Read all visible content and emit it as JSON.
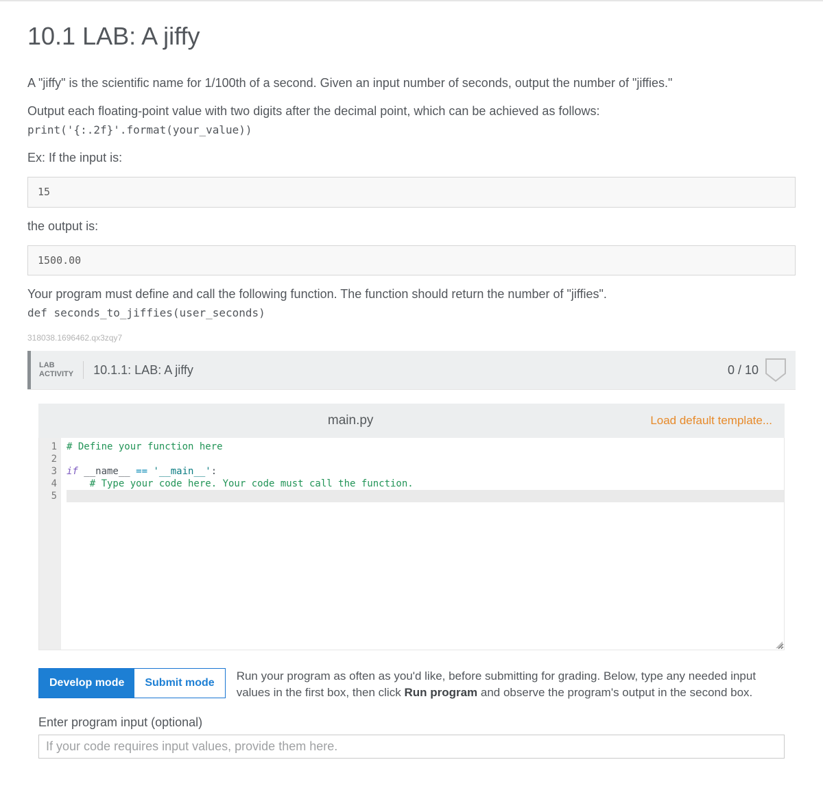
{
  "title": "10.1 LAB: A jiffy",
  "intro": {
    "p1": "A \"jiffy\" is the scientific name for 1/100th of a second. Given an input number of seconds, output the number of \"jiffies.\"",
    "p2": "Output each floating-point value with two digits after the decimal point, which can be achieved as follows:",
    "codeline": "print('{:.2f}'.format(your_value))",
    "p3": "Ex: If the input is:",
    "example_input": "15",
    "p4": "the output is:",
    "example_output": "1500.00",
    "p5": "Your program must define and call the following function. The function should return the number of \"jiffies\".",
    "defline": "def seconds_to_jiffies(user_seconds)"
  },
  "identifier": "318038.1696462.qx3zqy7",
  "activity": {
    "tag1": "LAB",
    "tag2": "ACTIVITY",
    "title": "10.1.1: LAB: A jiffy",
    "score": "0 / 10"
  },
  "editor": {
    "filename": "main.py",
    "load_default": "Load default template...",
    "gutters": [
      "1",
      "2",
      "3",
      "4",
      "5"
    ],
    "code": {
      "l1_comment": "# Define your function here",
      "l3_if": "if",
      "l3_name": " __name__ ",
      "l3_eq": "==",
      "l3_str": " '__main__'",
      "l3_colon": ":",
      "l4_comment": "    # Type your code here. Your code must call the function."
    }
  },
  "modes": {
    "develop": "Develop mode",
    "submit": "Submit mode"
  },
  "run_explain_pre": "Run your program as often as you'd like, before submitting for grading. Below, type any needed input values in the first box, then click ",
  "run_explain_bold": "Run program",
  "run_explain_post": " and observe the program's output in the second box.",
  "input_label": "Enter program input (optional)",
  "input_placeholder": "If your code requires input values, provide them here."
}
